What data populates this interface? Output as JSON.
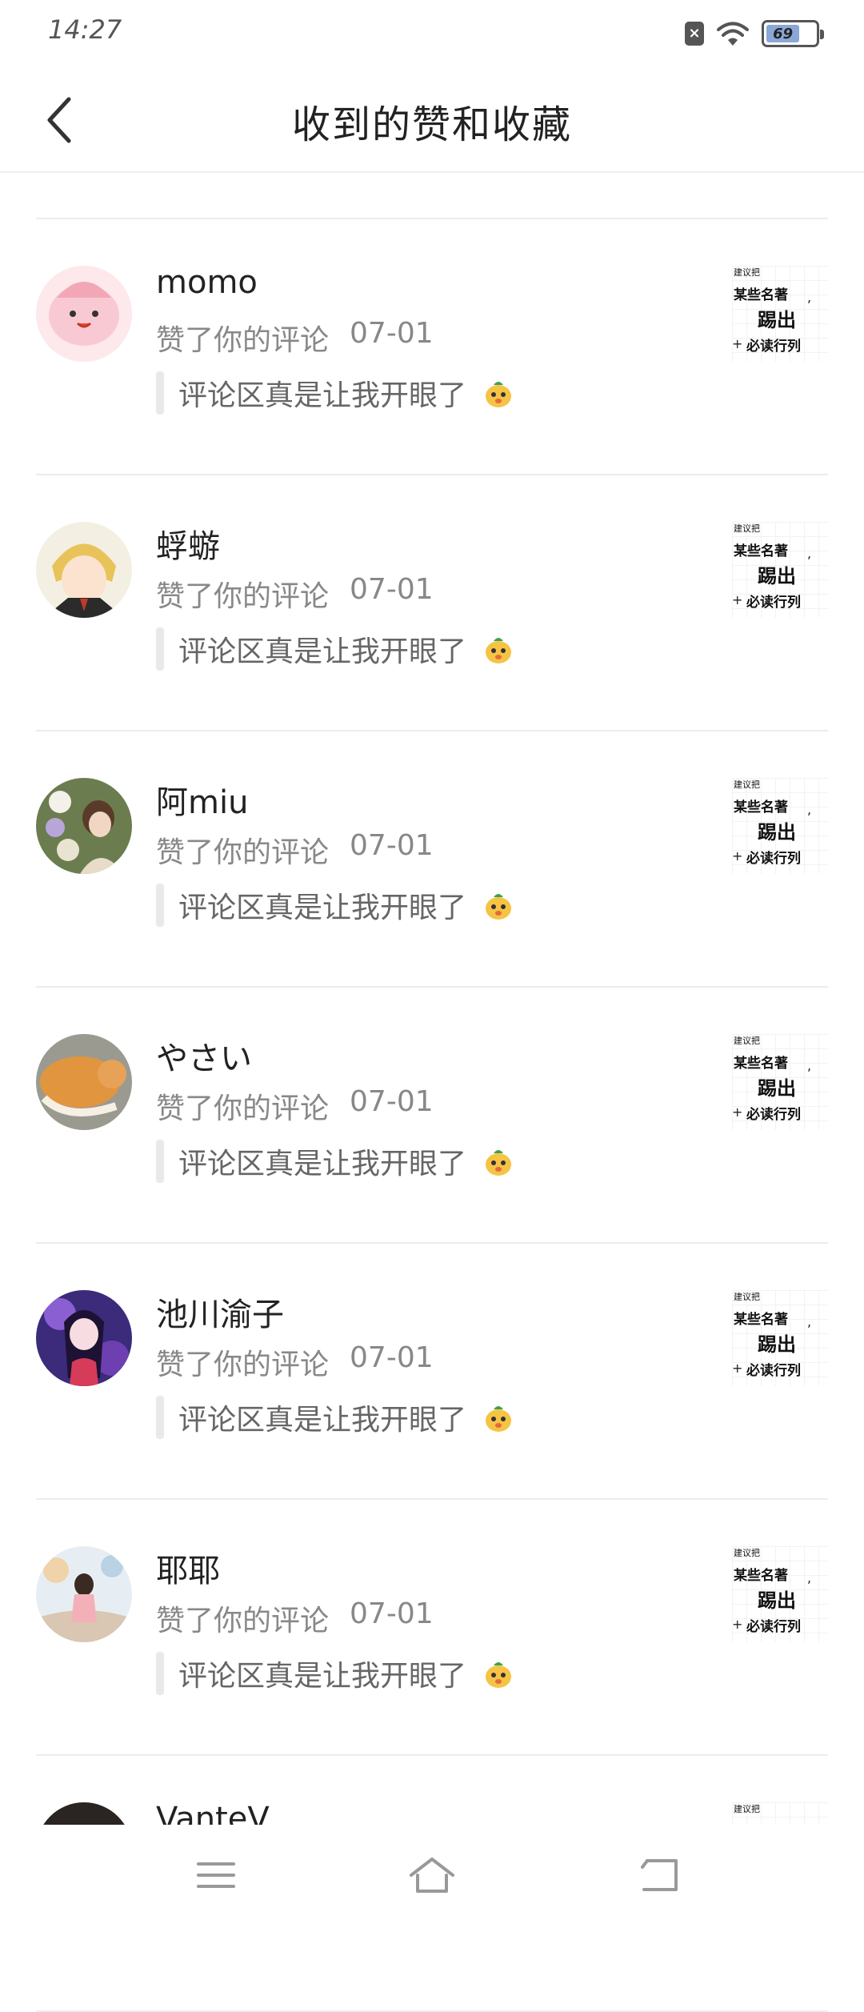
{
  "status": {
    "time": "14:27",
    "battery": "69"
  },
  "header": {
    "title": "收到的赞和收藏"
  },
  "thumbnail": {
    "small": "建议把",
    "line1": "某些名著",
    "big": "踢出",
    "line3": "必读行列"
  },
  "items": [
    {
      "name": "momo",
      "action": "赞了你的评论",
      "date": "07-01",
      "comment": "评论区真是让我开眼了"
    },
    {
      "name": "蜉蝣",
      "action": "赞了你的评论",
      "date": "07-01",
      "comment": "评论区真是让我开眼了"
    },
    {
      "name": "阿miu",
      "action": "赞了你的评论",
      "date": "07-01",
      "comment": "评论区真是让我开眼了"
    },
    {
      "name": "やさい",
      "action": "赞了你的评论",
      "date": "07-01",
      "comment": "评论区真是让我开眼了"
    },
    {
      "name": "池川渝子",
      "action": "赞了你的评论",
      "date": "07-01",
      "comment": "评论区真是让我开眼了"
    },
    {
      "name": "耶耶",
      "action": "赞了你的评论",
      "date": "07-01",
      "comment": "评论区真是让我开眼了"
    },
    {
      "name": "VanteV",
      "action": "",
      "date": "",
      "comment": ""
    }
  ],
  "icons": {
    "back": "back-chevron-icon",
    "menu": "menu-icon",
    "home": "home-icon",
    "return": "return-icon"
  }
}
